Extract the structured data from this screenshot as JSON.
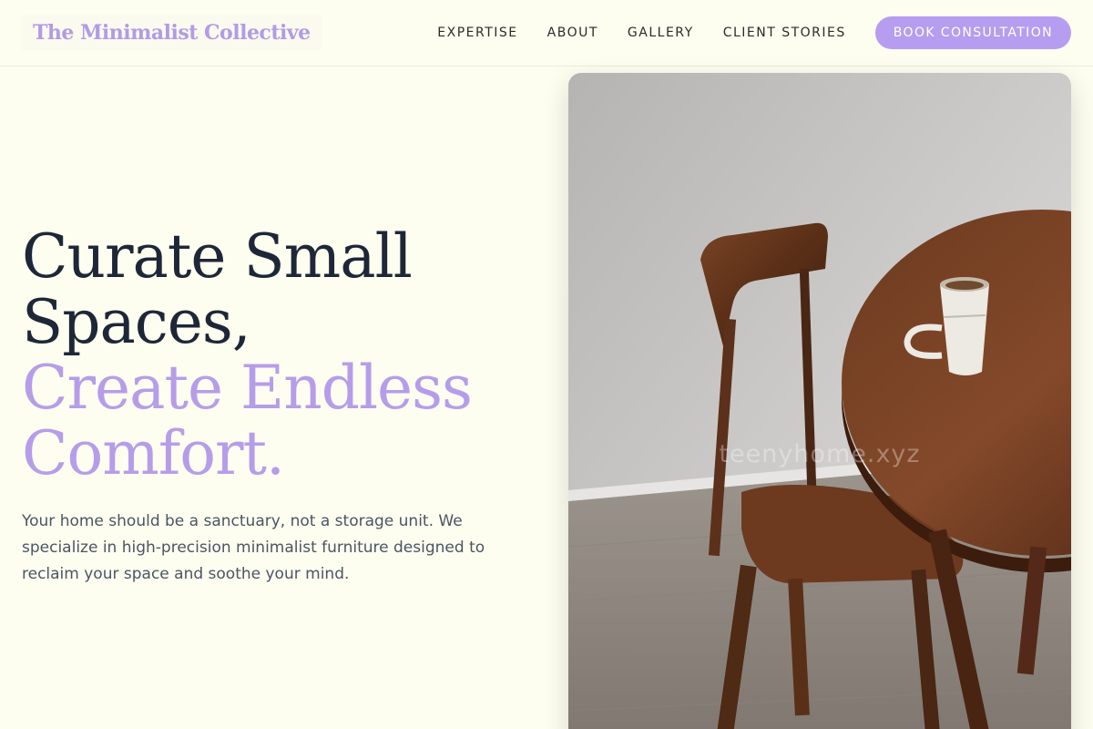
{
  "brand": {
    "name": "The Minimalist Collective"
  },
  "nav": {
    "links": [
      "EXPERTISE",
      "ABOUT",
      "GALLERY",
      "CLIENT STORIES"
    ],
    "cta_label": "BOOK CONSULTATION"
  },
  "hero": {
    "headline_line1": "Curate Small",
    "headline_line2": "Spaces,",
    "headline_accent1": "Create Endless",
    "headline_accent2": "Comfort.",
    "lead": "Your home should be a sanctuary, not a storage unit. We specialize in high-precision minimalist furniture designed to reclaim your space and soothe your mind."
  },
  "image": {
    "watermark": "teenyhome.xyz"
  },
  "colors": {
    "background": "#fdfdf0",
    "accent": "#b69df0",
    "heading": "#1e2738",
    "body_text": "#4b5563"
  }
}
